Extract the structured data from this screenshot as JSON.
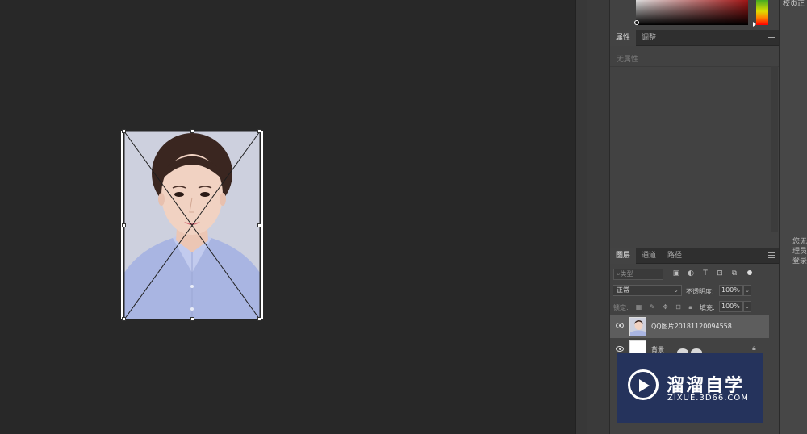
{
  "right_edge": {
    "top_text": "校页正",
    "message": "您无理员登录"
  },
  "properties_panel": {
    "tabs": [
      "属性",
      "调整"
    ],
    "empty_text": "无属性"
  },
  "layers_panel": {
    "tabs": [
      "图层",
      "通道",
      "路径"
    ],
    "filter_placeholder": "类型",
    "blend_mode": "正常",
    "opacity_label": "不透明度:",
    "opacity_value": "100%",
    "lock_label": "锁定:",
    "fill_label": "填充:",
    "fill_value": "100%",
    "layers": [
      {
        "name": "QQ图片20181120094558",
        "selected": true
      },
      {
        "name": "背景",
        "selected": false,
        "locked": true
      }
    ]
  },
  "watermark": {
    "title": "溜溜自学",
    "subtitle": "ZIXUE.3D66.COM"
  },
  "colors": {
    "canvas_bg": "#282828",
    "panel_bg": "#424242",
    "selected_layer": "#5d5d5d",
    "logo_bg": "#25335c",
    "shirt_blue": "#a8b4e0"
  },
  "icons": [
    "eye-icon",
    "menu-icon",
    "play-logo-icon",
    "lock-icon",
    "search-icon"
  ]
}
